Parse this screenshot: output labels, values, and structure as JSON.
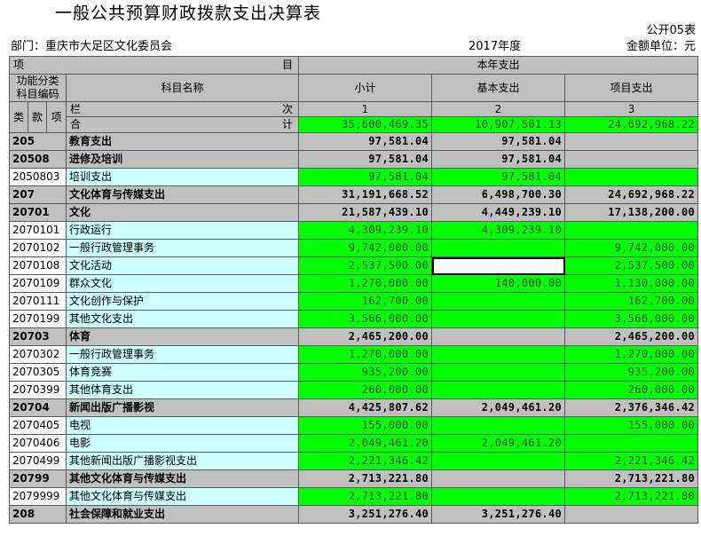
{
  "header": {
    "title": "一般公共预算财政拨款支出决算表",
    "form_code": "公开05表",
    "department": "部门：重庆市大足区文化委员会",
    "year": "2017年度",
    "unit": "金额单位：元"
  },
  "columns": {
    "item_left": "项",
    "item_right": "目",
    "current_year": "本年支出",
    "func_code": "功能分类科目编码",
    "subject_name": "科目名称",
    "subtotal": "小计",
    "basic": "基本支出",
    "project": "项目支出",
    "lei": "类",
    "kuan": "款",
    "xiang": "项",
    "lan": "栏",
    "ci": "次",
    "he": "合",
    "ji": "计",
    "col1": "1",
    "col2": "2",
    "col3": "3"
  },
  "totals": {
    "subtotal": "35,600,469.35",
    "basic": "10,907,501.13",
    "project": "24,692,968.22"
  },
  "rows": [
    {
      "code": "205",
      "name": "教育支出",
      "subtotal": "97,581.04",
      "basic": "97,581.04",
      "project": "",
      "level": 1
    },
    {
      "code": "20508",
      "name": "进修及培训",
      "subtotal": "97,581.04",
      "basic": "97,581.04",
      "project": "",
      "level": 1
    },
    {
      "code": "2050803",
      "name": "培训支出",
      "subtotal": "97,581.04",
      "basic": "97,581.04",
      "project": "",
      "level": 3
    },
    {
      "code": "207",
      "name": "文化体育与传媒支出",
      "subtotal": "31,191,668.52",
      "basic": "6,498,700.30",
      "project": "24,692,968.22",
      "level": 1
    },
    {
      "code": "20701",
      "name": "文化",
      "subtotal": "21,587,439.10",
      "basic": "4,449,239.10",
      "project": "17,138,200.00",
      "level": 1
    },
    {
      "code": "2070101",
      "name": "行政运行",
      "subtotal": "4,309,239.10",
      "basic": "4,309,239.10",
      "project": "",
      "level": 3
    },
    {
      "code": "2070102",
      "name": "一般行政管理事务",
      "subtotal": "9,742,000.00",
      "basic": "",
      "project": "9,742,000.00",
      "level": 3
    },
    {
      "code": "2070108",
      "name": "文化活动",
      "subtotal": "2,537,500.00",
      "basic": "",
      "project": "2,537,500.00",
      "level": 3,
      "selected": true
    },
    {
      "code": "2070109",
      "name": "群众文化",
      "subtotal": "1,270,000.00",
      "basic": "140,000.00",
      "project": "1,130,000.00",
      "level": 3
    },
    {
      "code": "2070111",
      "name": "文化创作与保护",
      "subtotal": "162,700.00",
      "basic": "",
      "project": "162,700.00",
      "level": 3
    },
    {
      "code": "2070199",
      "name": "其他文化支出",
      "subtotal": "3,566,000.00",
      "basic": "",
      "project": "3,566,000.00",
      "level": 3
    },
    {
      "code": "20703",
      "name": "体育",
      "subtotal": "2,465,200.00",
      "basic": "",
      "project": "2,465,200.00",
      "level": 1
    },
    {
      "code": "2070302",
      "name": "一般行政管理事务",
      "subtotal": "1,270,000.00",
      "basic": "",
      "project": "1,270,000.00",
      "level": 3
    },
    {
      "code": "2070305",
      "name": "体育竞赛",
      "subtotal": "935,200.00",
      "basic": "",
      "project": "935,200.00",
      "level": 3
    },
    {
      "code": "2070399",
      "name": "其他体育支出",
      "subtotal": "260,000.00",
      "basic": "",
      "project": "260,000.00",
      "level": 3
    },
    {
      "code": "20704",
      "name": "新闻出版广播影视",
      "subtotal": "4,425,807.62",
      "basic": "2,049,461.20",
      "project": "2,376,346.42",
      "level": 1
    },
    {
      "code": "2070405",
      "name": "电视",
      "subtotal": "155,000.00",
      "basic": "",
      "project": "155,000.00",
      "level": 3
    },
    {
      "code": "2070406",
      "name": "电影",
      "subtotal": "2,049,461.20",
      "basic": "2,049,461.20",
      "project": "",
      "level": 3
    },
    {
      "code": "2070499",
      "name": "其他新闻出版广播影视支出",
      "subtotal": "2,221,346.42",
      "basic": "",
      "project": "2,221,346.42",
      "level": 3
    },
    {
      "code": "20799",
      "name": "其他文化体育与传媒支出",
      "subtotal": "2,713,221.80",
      "basic": "",
      "project": "2,713,221.80",
      "level": 1
    },
    {
      "code": "2079999",
      "name": "其他文化体育与传媒支出",
      "subtotal": "2,713,221.80",
      "basic": "",
      "project": "2,713,221.80",
      "level": 3
    },
    {
      "code": "208",
      "name": "社会保障和就业支出",
      "subtotal": "3,251,276.40",
      "basic": "3,251,276.40",
      "project": "",
      "level": 1
    }
  ]
}
